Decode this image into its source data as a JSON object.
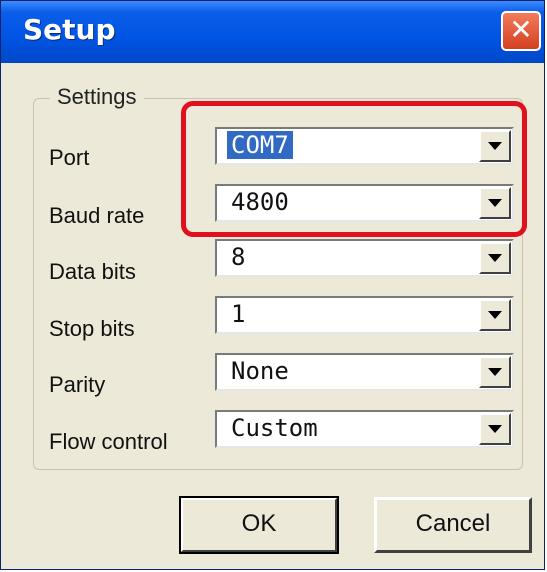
{
  "window": {
    "title": "Setup",
    "close_glyph": "✕",
    "close_icon": "close-icon"
  },
  "settings": {
    "group_label": "Settings",
    "port": {
      "label": "Port",
      "value": "COM7",
      "selected": true
    },
    "baud_rate": {
      "label": "Baud rate",
      "value": "4800"
    },
    "data_bits": {
      "label": "Data bits",
      "value": "8"
    },
    "stop_bits": {
      "label": "Stop bits",
      "value": "1"
    },
    "parity": {
      "label": "Parity",
      "value": "None"
    },
    "flow_control": {
      "label": "Flow control",
      "value": "Custom"
    }
  },
  "buttons": {
    "ok": "OK",
    "cancel": "Cancel"
  },
  "colors": {
    "titlebar": "#0054e3",
    "selection": "#316ac5",
    "highlight_box": "#e0101e",
    "dialog_bg": "#ece9d8"
  }
}
